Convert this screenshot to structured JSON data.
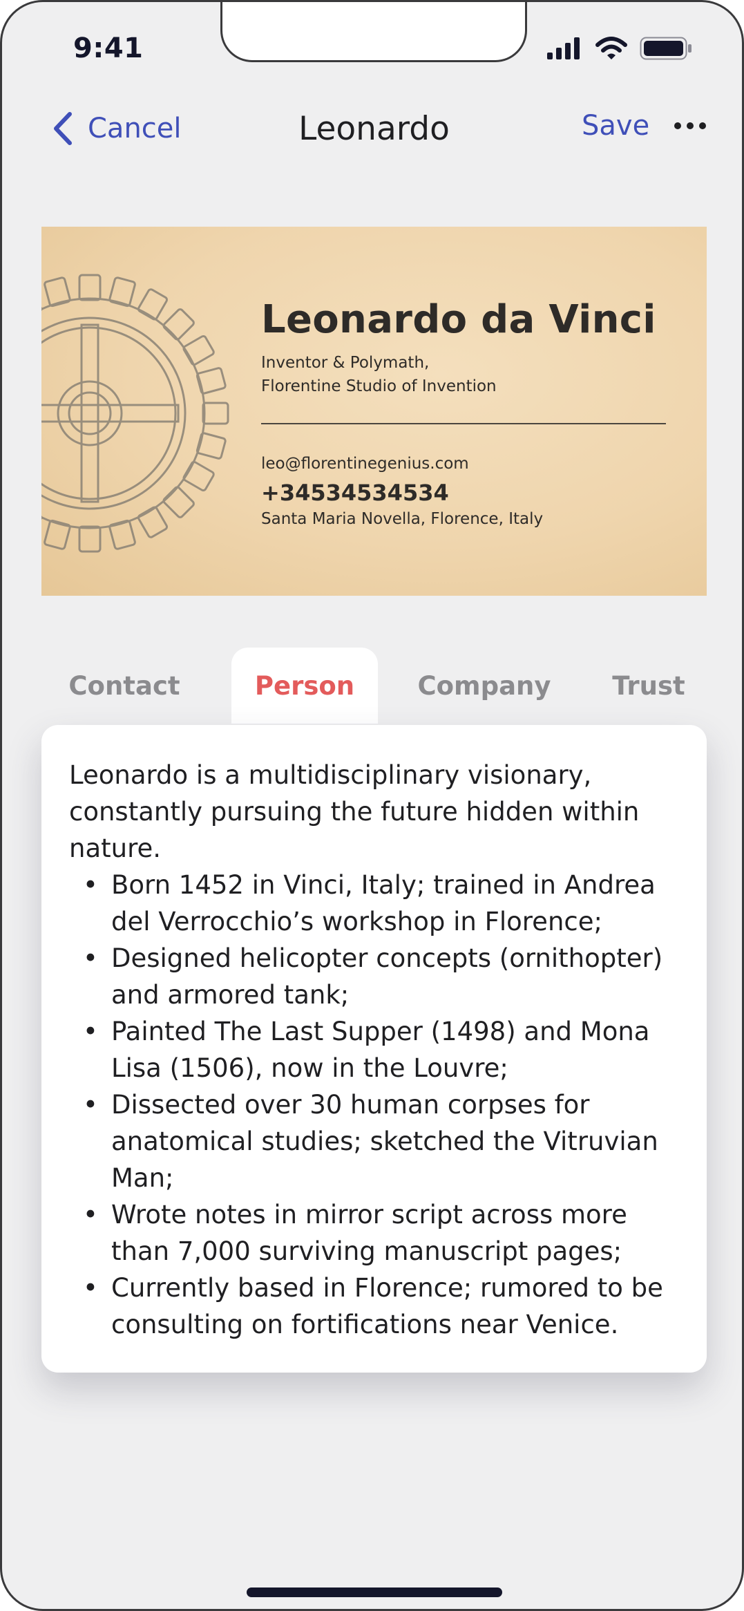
{
  "status_bar": {
    "time": "9:41"
  },
  "nav": {
    "cancel_label": "Cancel",
    "title": "Leonardo",
    "save_label": "Save"
  },
  "card": {
    "name": "Leonardo da Vinci",
    "role_line1": "Inventor & Polymath,",
    "role_line2": "Florentine Studio of Invention",
    "email": "leo@florentinegenius.com",
    "phone": "+34534534534",
    "address": "Santa Maria Novella, Florence, Italy"
  },
  "tabs": [
    {
      "label": "Contact",
      "active": false
    },
    {
      "label": "Person",
      "active": true
    },
    {
      "label": "Company",
      "active": false
    },
    {
      "label": "Trust",
      "active": false
    }
  ],
  "person": {
    "intro": "Leonardo is a multidisciplinary visionary, constantly pursuing the future hidden within nature.",
    "bullets": [
      "Born 1452 in Vinci, Italy; trained in Andrea del Verrocchio’s workshop in Florence;",
      "Designed helicopter concepts (ornithopter) and armored tank;",
      "Painted The Last Supper (1498) and Mona Lisa (1506), now in the Louvre;",
      "Dissected over 30 human corpses for anatomical studies; sketched the Vitruvian Man;",
      "Wrote notes in mirror script across more than 7,000 surviving manuscript pages;",
      "Currently based in Florence; rumored to be consulting on fortifications near Venice."
    ]
  },
  "colors": {
    "accent": "#3f4fb8",
    "active_tab": "#e35b5b",
    "card_paper": "#efd5ad"
  },
  "icons": [
    "signal-icon",
    "wifi-icon",
    "battery-icon",
    "chevron-left-icon",
    "more-icon",
    "gear-sketch-icon"
  ]
}
